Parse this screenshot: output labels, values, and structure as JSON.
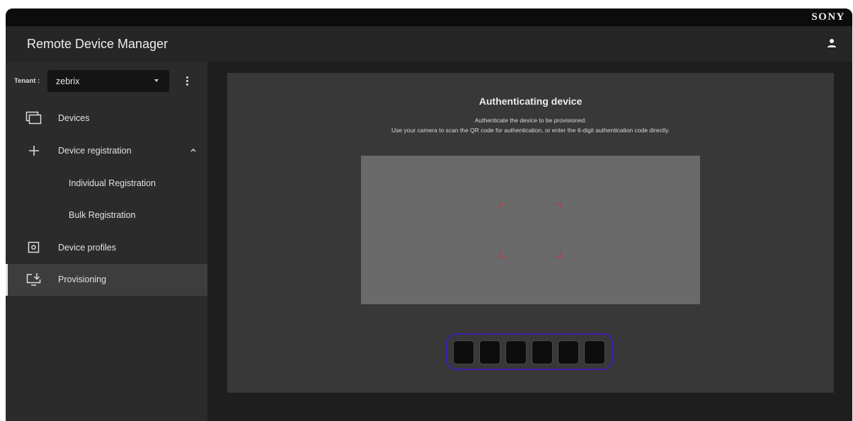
{
  "brand": "SONY",
  "app_title": "Remote Device Manager",
  "header_icons": {
    "user": "user-icon"
  },
  "tenant": {
    "label": "Tenant :",
    "value": "zebrix"
  },
  "nav": {
    "devices": "Devices",
    "device_registration": "Device registration",
    "individual_registration": "Individual Registration",
    "bulk_registration": "Bulk Registration",
    "device_profiles": "Device profiles",
    "provisioning": "Provisioning"
  },
  "main": {
    "title": "Authenticating device",
    "desc_line1": "Authenticate the device to be provisioned.",
    "desc_line2": "Use your camera to scan the QR code for authentication, or enter the 6-digit authentication code directly.",
    "code_digits": 6
  },
  "colors": {
    "accent_focus": "#3f1fa8",
    "scan_corner": "#c0353d"
  }
}
